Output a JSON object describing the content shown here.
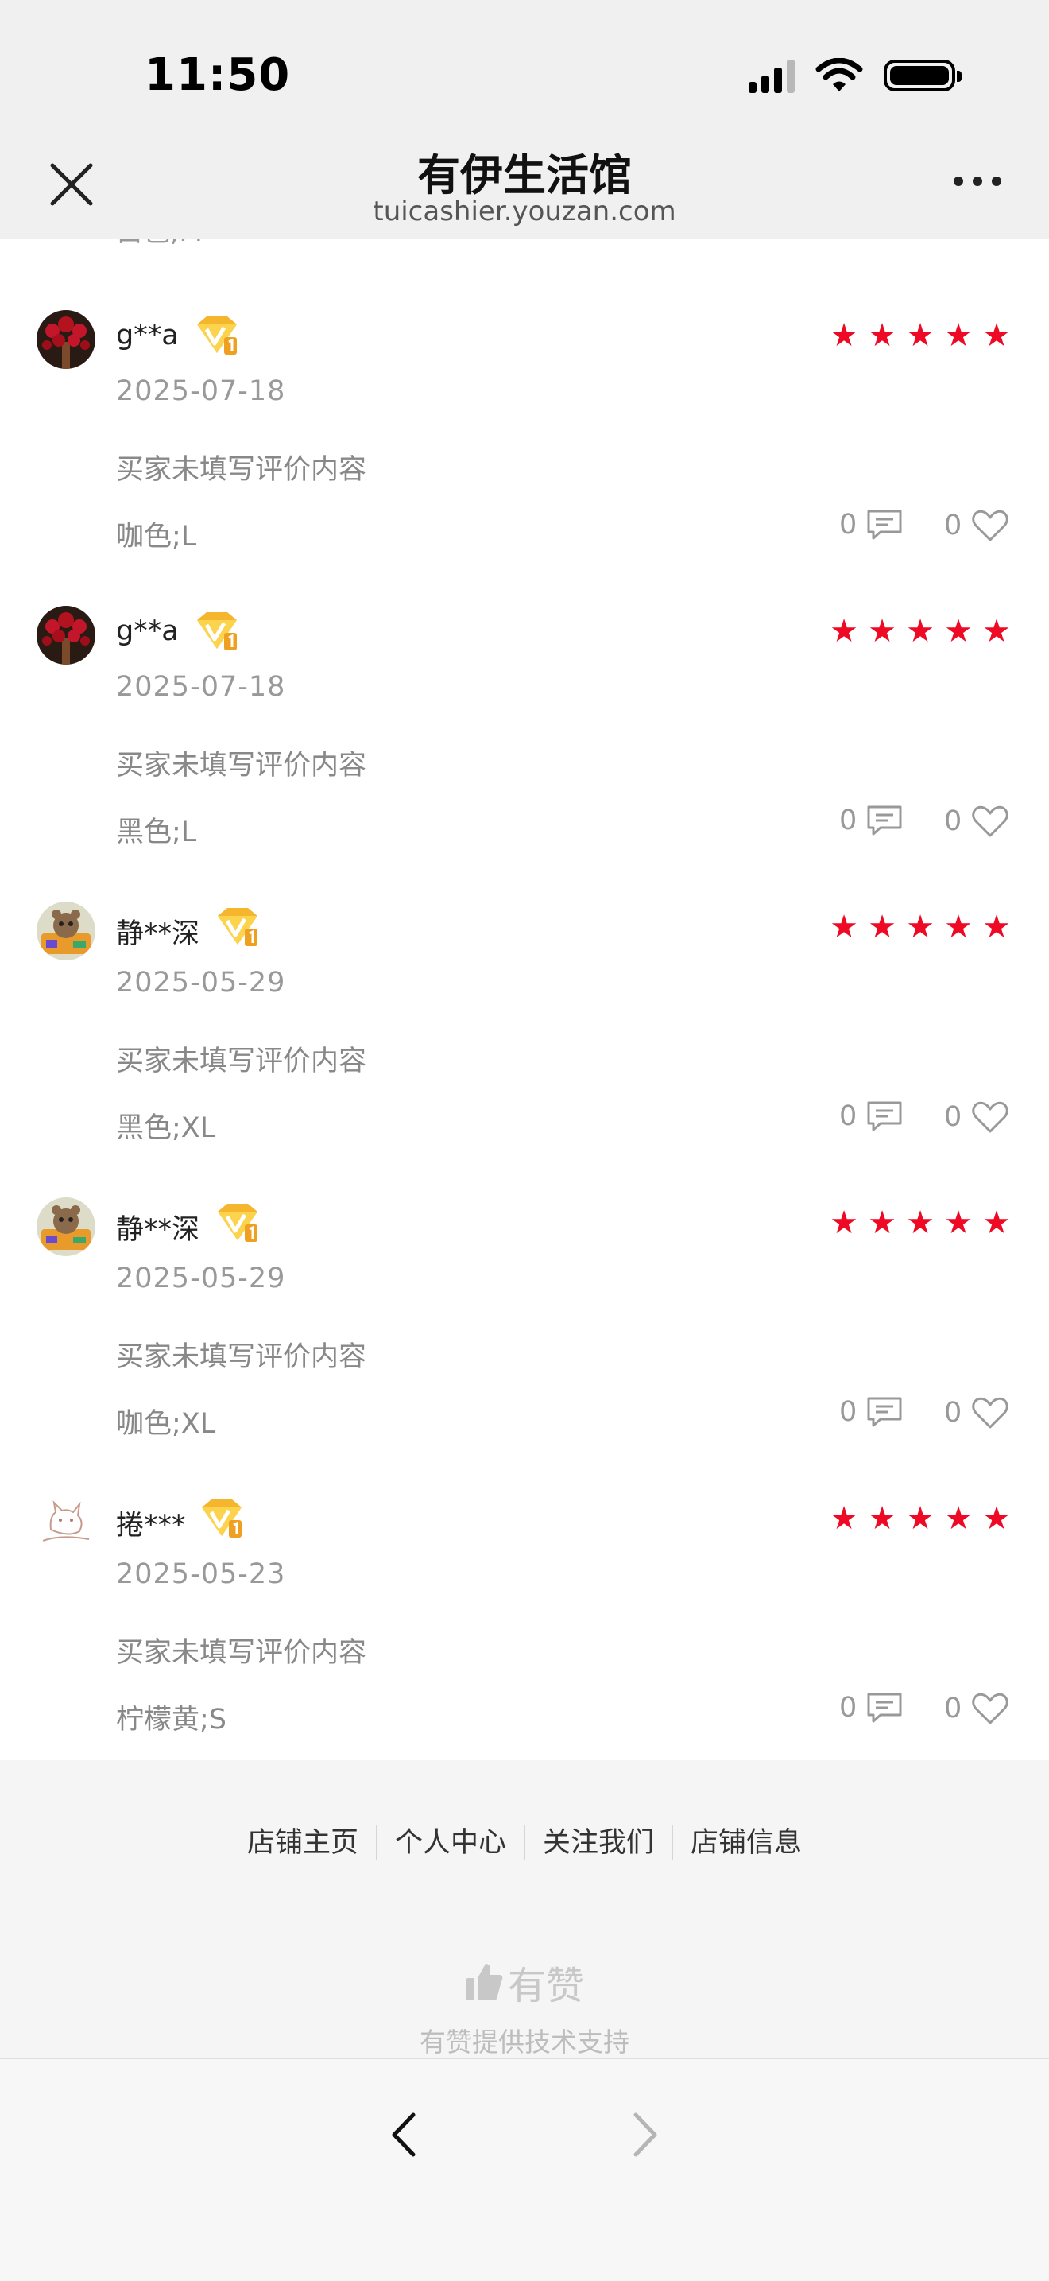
{
  "status": {
    "time": "11:50"
  },
  "nav": {
    "title": "有伊生活馆",
    "subtitle": "tuicashier.youzan.com"
  },
  "partial_row": {
    "sku": "白色;M"
  },
  "reviews": [
    {
      "username": "g**a",
      "date": "2025-07-18",
      "content": "买家未填写评价内容",
      "sku": "咖色;L",
      "comments": "0",
      "likes": "0",
      "rating": 5,
      "avatar": "apple-tree"
    },
    {
      "username": "g**a",
      "date": "2025-07-18",
      "content": "买家未填写评价内容",
      "sku": "黑色;L",
      "comments": "0",
      "likes": "0",
      "rating": 5,
      "avatar": "apple-tree"
    },
    {
      "username": "静**深",
      "date": "2025-05-29",
      "content": "买家未填写评价内容",
      "sku": "黑色;XL",
      "comments": "0",
      "likes": "0",
      "rating": 5,
      "avatar": "cartoon-bear"
    },
    {
      "username": "静**深",
      "date": "2025-05-29",
      "content": "买家未填写评价内容",
      "sku": "咖色;XL",
      "comments": "0",
      "likes": "0",
      "rating": 5,
      "avatar": "cartoon-bear"
    },
    {
      "username": "捲***",
      "date": "2025-05-23",
      "content": "买家未填写评价内容",
      "sku": "柠檬黄;S",
      "comments": "0",
      "likes": "0",
      "rating": 5,
      "avatar": "sketch-cat"
    }
  ],
  "footer": {
    "links": [
      "店铺主页",
      "个人中心",
      "关注我们",
      "店铺信息"
    ],
    "brand": "有赞",
    "support": "有赞提供技术支持"
  },
  "colors": {
    "star": "#ee0a24",
    "vip_badge": "#f5b52c",
    "muted_text": "#999999"
  }
}
